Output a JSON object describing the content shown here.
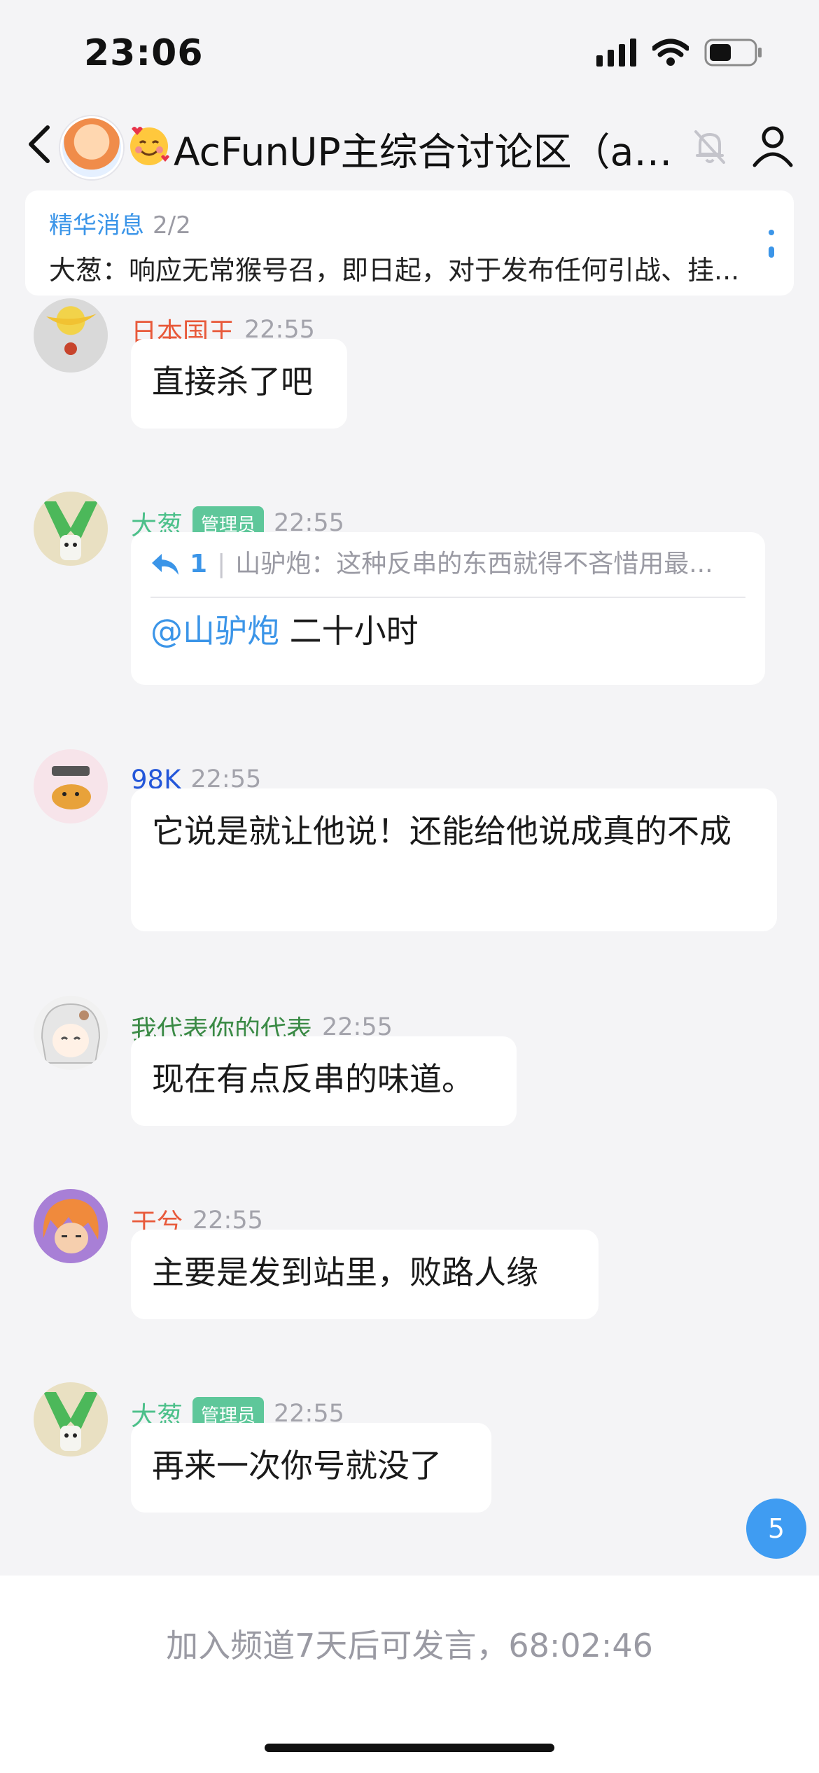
{
  "status_bar": {
    "time": "23:06"
  },
  "header": {
    "title": "AcFunUP主综合讨论区（av...",
    "title_emoji": "smiling-face-with-hearts"
  },
  "pinned": {
    "label": "精华消息",
    "count": "2/2",
    "text": "大葱：响应无常猴号召，即日起，对于发布任何引战、挂..."
  },
  "messages": [
    {
      "name": "日本国王",
      "name_color": "#e8593a",
      "time": "22:55",
      "text": "直接杀了吧"
    },
    {
      "name": "大葱",
      "name_color": "#4cc08a",
      "badge": "管理员",
      "time": "22:55",
      "quote": {
        "count": "1",
        "text": "山驴炮：这种反串的东西就得不吝惜用最..."
      },
      "mention": "@山驴炮",
      "text": " 二十小时"
    },
    {
      "name": "98K",
      "name_color": "#2356d9",
      "time": "22:55",
      "text": "它说是就让他说！还能给他说成真的不成"
    },
    {
      "name": "我代表你的代表",
      "name_color": "#3a8a45",
      "time": "22:55",
      "text": "现在有点反串的味道。"
    },
    {
      "name": "于兮",
      "name_color": "#e8593a",
      "time": "22:55",
      "text": "主要是发到站里，败路人缘"
    },
    {
      "name": "大葱",
      "name_color": "#4cc08a",
      "badge": "管理员",
      "time": "22:55",
      "text": "再来一次你号就没了"
    }
  ],
  "unread_count": "5",
  "footer": {
    "text": "加入频道7天后可发言，68:02:46"
  }
}
